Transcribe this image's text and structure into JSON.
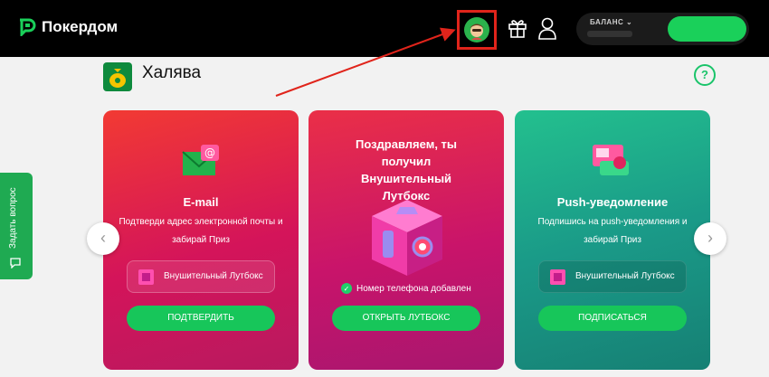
{
  "header": {
    "brand_name": "Покердом",
    "balance_label": "БАЛАНС"
  },
  "side_tab": {
    "label": "Задать вопрос"
  },
  "page": {
    "title": "Халява"
  },
  "cards": [
    {
      "title": "E-mail",
      "description": "Подтверди адрес электронной почты и забирай Приз",
      "prize": "Внушительный Лутбокс",
      "button": "ПОДТВЕРДИТЬ"
    },
    {
      "title": "Поздравляем, ты получил Внушительный Лутбокс",
      "status": "Номер телефона добавлен",
      "button": "ОТКРЫТЬ ЛУТБОКС"
    },
    {
      "title": "Push-уведомление",
      "description": "Подпишись на push-уведомления и забирай Приз",
      "prize": "Внушительный Лутбокс",
      "button": "ПОДПИСАТЬСЯ"
    }
  ],
  "colors": {
    "accent_green": "#1ad05a",
    "highlight_red": "#e0241b"
  }
}
